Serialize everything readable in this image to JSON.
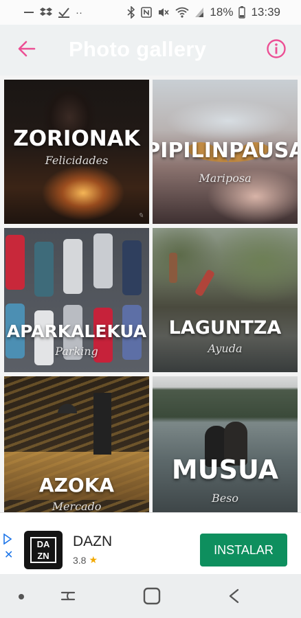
{
  "status_bar": {
    "left_icons": [
      "minus-icon",
      "dropbox-icon",
      "check-icon",
      "more-icon"
    ],
    "battery_percent": "18%",
    "time": "13:39"
  },
  "app_bar": {
    "title": "Photo gallery",
    "accent_color": "#ec4f94"
  },
  "gallery": {
    "tiles": [
      {
        "title": "ZORIONAK",
        "subtitle": "Felicidades"
      },
      {
        "title": "PIPILINPAUSA",
        "subtitle": "Mariposa"
      },
      {
        "title": "APARKALEKUA",
        "subtitle": "Parking"
      },
      {
        "title": "LAGUNTZA",
        "subtitle": "Ayuda"
      },
      {
        "title": "AZOKA",
        "subtitle": "Mercado"
      },
      {
        "title": "MUSUA",
        "subtitle": "Beso"
      }
    ]
  },
  "ad": {
    "logo_text": [
      "DA",
      "ZN"
    ],
    "app_name": "DAZN",
    "rating": "3.8",
    "install_label": "INSTALAR",
    "install_color": "#0e8f5e"
  }
}
